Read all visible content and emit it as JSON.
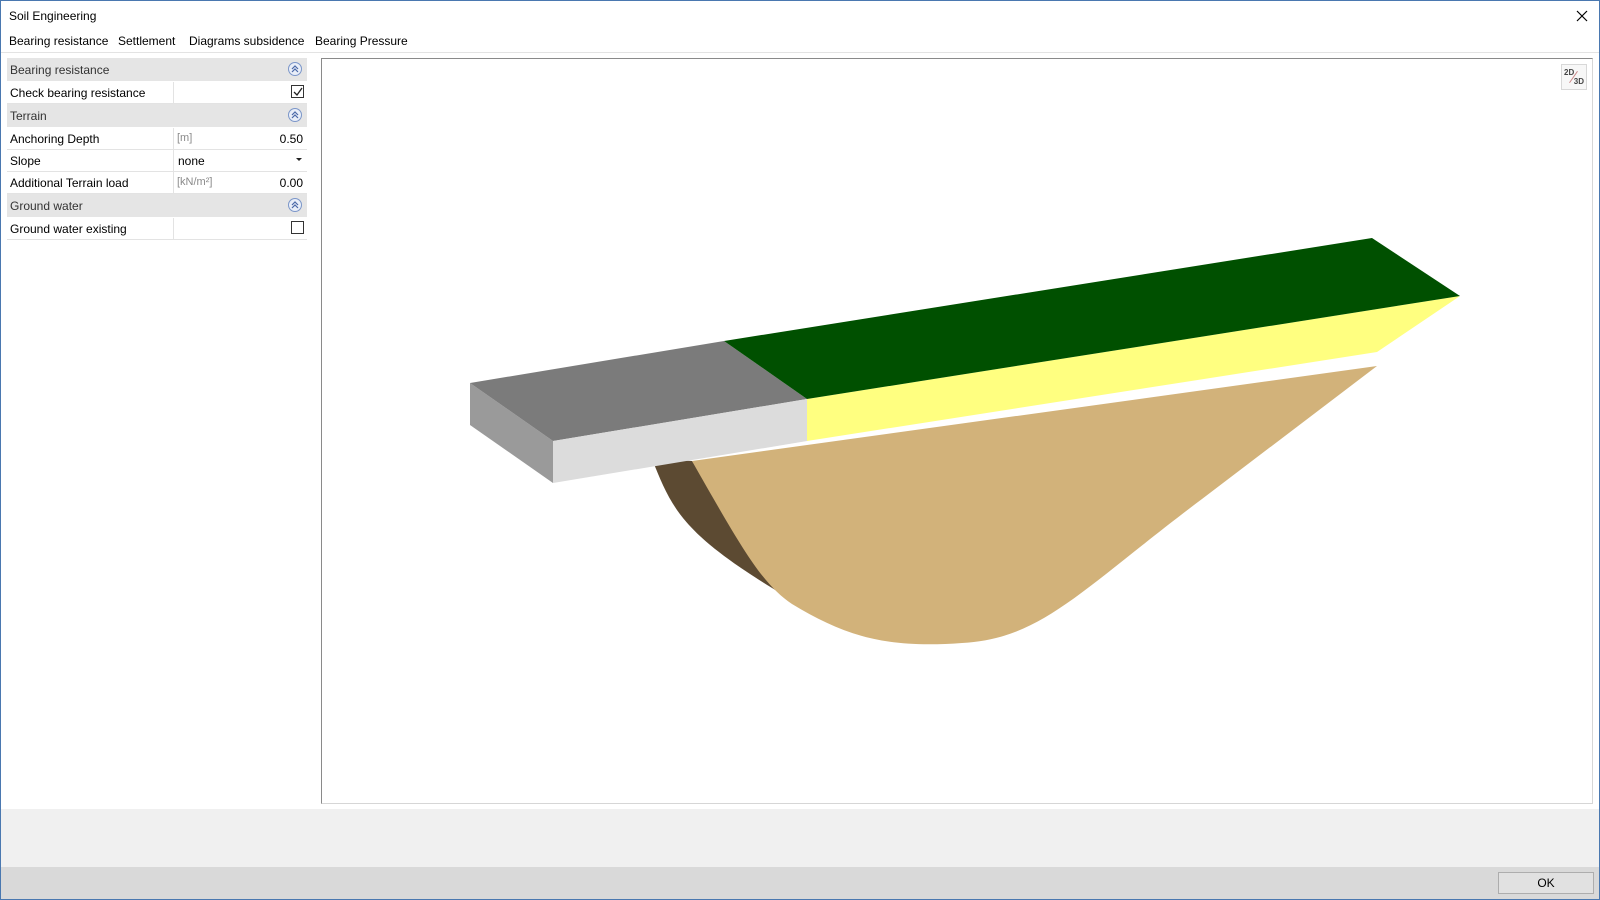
{
  "window": {
    "title": "Soil Engineering"
  },
  "tabs": [
    {
      "label": "Bearing resistance"
    },
    {
      "label": "Settlement"
    },
    {
      "label": "Diagrams subsidence"
    },
    {
      "label": "Bearing Pressure"
    }
  ],
  "panel": {
    "bearing": {
      "header": "Bearing resistance",
      "check_label": "Check bearing resistance",
      "check_value": true
    },
    "terrain": {
      "header": "Terrain",
      "anchoring_label": "Anchoring Depth",
      "anchoring_unit": "[m]",
      "anchoring_value": "0.50",
      "slope_label": "Slope",
      "slope_value": "none",
      "load_label": "Additional Terrain load",
      "load_unit": "[kN/m²]",
      "load_value": "0.00"
    },
    "groundwater": {
      "header": "Ground water",
      "existing_label": "Ground water existing",
      "existing_value": false
    }
  },
  "viewport": {
    "toggle_2d": "2D",
    "toggle_3d": "3D",
    "colors": {
      "foundation_top": "#7b7b7b",
      "foundation_side": "#9a9a9a",
      "foundation_front": "#dcdcdc",
      "terrain_top": "#005000",
      "layer_face": "#ffff80",
      "failure_body": "#d2b27a",
      "failure_shadow": "#5c4a32"
    }
  },
  "footer": {
    "ok_label": "OK"
  }
}
